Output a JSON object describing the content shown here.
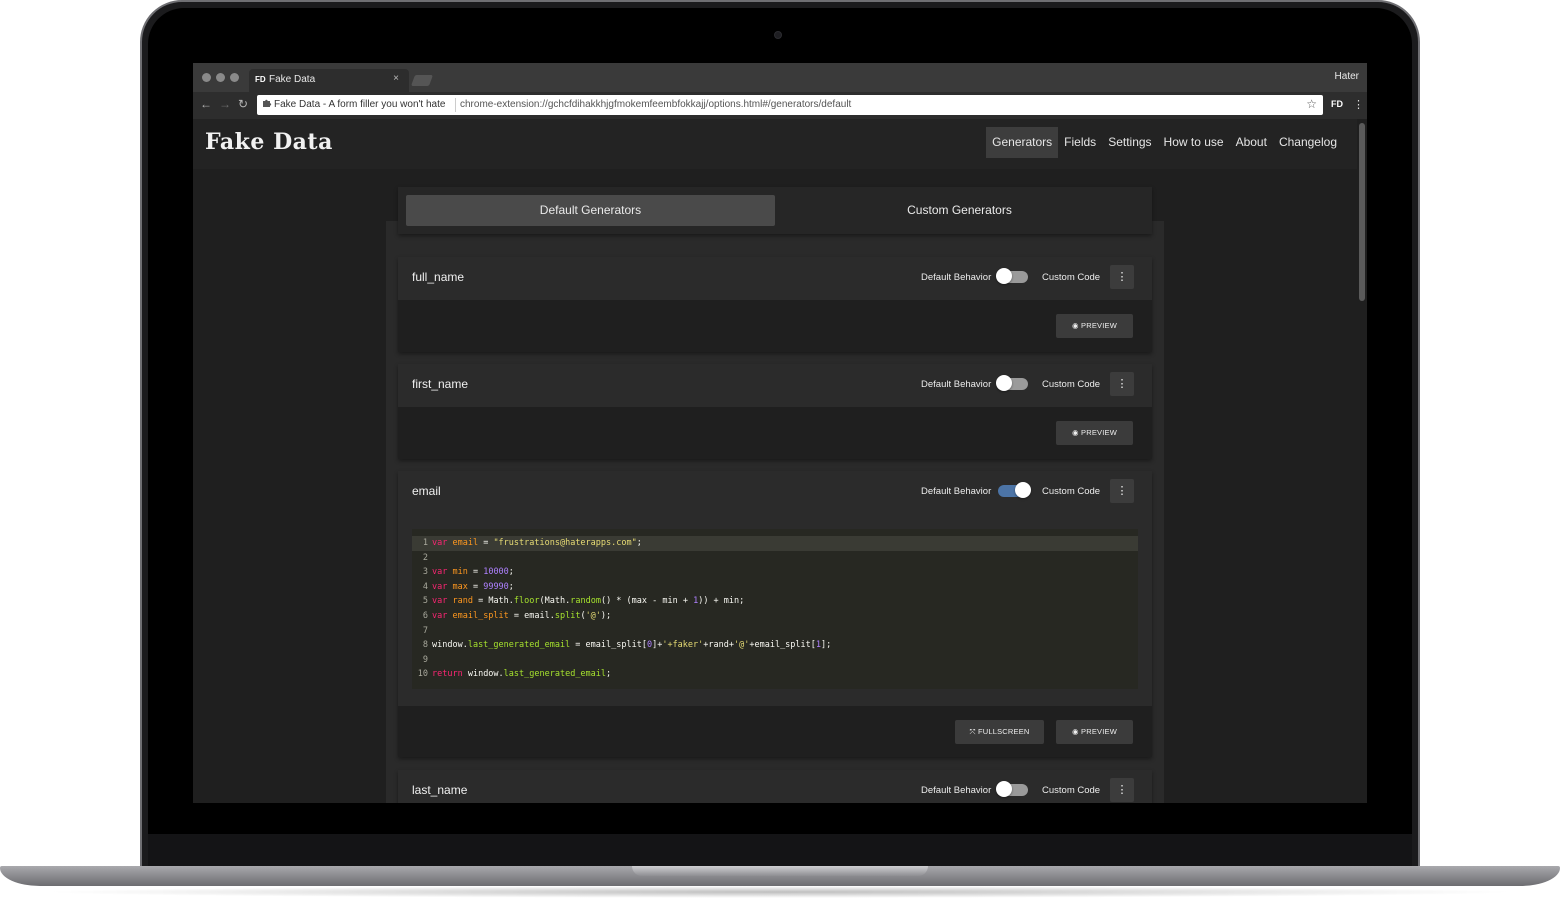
{
  "browser": {
    "tab_favicon": "FD",
    "tab_title": "Fake Data",
    "tab_close": "×",
    "profile": "Hater",
    "site_label": "Fake Data - A form filler you won't hate",
    "url": "chrome-extension://gchcfdihakkhjgfmokemfeembfokkajj/options.html#/generators/default",
    "extension_label": "FD",
    "icons": {
      "back": "←",
      "forward": "→",
      "reload": "↻",
      "star": "☆",
      "menu": "⋮",
      "site": "puzzle-icon"
    }
  },
  "app": {
    "logo": "Fake Data",
    "nav": [
      "Generators",
      "Fields",
      "Settings",
      "How to use",
      "About",
      "Changelog"
    ],
    "active_nav": "Generators"
  },
  "generator_tabs": {
    "default": "Default Generators",
    "custom": "Custom Generators"
  },
  "labels": {
    "default_behavior": "Default Behavior",
    "custom_code": "Custom Code",
    "kebab": "⋮"
  },
  "buttons": {
    "preview": "PREVIEW",
    "fullscreen": "FULLSCREEN",
    "preview_icon": "◉",
    "fullscreen_icon": "⤧"
  },
  "generators": [
    {
      "name": "full_name",
      "custom_code": false
    },
    {
      "name": "first_name",
      "custom_code": false
    },
    {
      "name": "email",
      "custom_code": true
    },
    {
      "name": "last_name",
      "custom_code": false
    }
  ],
  "code_lines": [
    {
      "n": "1",
      "parts": [
        [
          "kw",
          "var"
        ],
        [
          "def",
          " "
        ],
        [
          "var",
          "email"
        ],
        [
          "def",
          " = "
        ],
        [
          "str",
          "\"frustrations@haterapps.com\""
        ],
        [
          "def",
          ";"
        ]
      ]
    },
    {
      "n": "2",
      "parts": []
    },
    {
      "n": "3",
      "parts": [
        [
          "kw",
          "var"
        ],
        [
          "def",
          " "
        ],
        [
          "var",
          "min"
        ],
        [
          "def",
          " = "
        ],
        [
          "num",
          "10000"
        ],
        [
          "def",
          ";"
        ]
      ]
    },
    {
      "n": "4",
      "parts": [
        [
          "kw",
          "var"
        ],
        [
          "def",
          " "
        ],
        [
          "var",
          "max"
        ],
        [
          "def",
          " = "
        ],
        [
          "num",
          "99990"
        ],
        [
          "def",
          ";"
        ]
      ]
    },
    {
      "n": "5",
      "parts": [
        [
          "kw",
          "var"
        ],
        [
          "def",
          " "
        ],
        [
          "var",
          "rand"
        ],
        [
          "def",
          " = Math."
        ],
        [
          "fn",
          "floor"
        ],
        [
          "def",
          "(Math."
        ],
        [
          "fn",
          "random"
        ],
        [
          "def",
          "() * (max - min + "
        ],
        [
          "num",
          "1"
        ],
        [
          "def",
          ")) + min;"
        ]
      ]
    },
    {
      "n": "6",
      "parts": [
        [
          "kw",
          "var"
        ],
        [
          "def",
          " "
        ],
        [
          "var",
          "email_split"
        ],
        [
          "def",
          " = email."
        ],
        [
          "fn",
          "split"
        ],
        [
          "def",
          "("
        ],
        [
          "str",
          "'@'"
        ],
        [
          "def",
          ");"
        ]
      ]
    },
    {
      "n": "7",
      "parts": []
    },
    {
      "n": "8",
      "parts": [
        [
          "def",
          "window."
        ],
        [
          "fn",
          "last_generated_email"
        ],
        [
          "def",
          " = email_split["
        ],
        [
          "num",
          "0"
        ],
        [
          "def",
          "]+"
        ],
        [
          "str",
          "'+faker'"
        ],
        [
          "def",
          "+rand+"
        ],
        [
          "str",
          "'@'"
        ],
        [
          "def",
          "+email_split["
        ],
        [
          "num",
          "1"
        ],
        [
          "def",
          "];"
        ]
      ]
    },
    {
      "n": "9",
      "parts": []
    },
    {
      "n": "10",
      "parts": [
        [
          "kw",
          "return"
        ],
        [
          "def",
          " window."
        ],
        [
          "fn",
          "last_generated_email"
        ],
        [
          "def",
          ";"
        ]
      ]
    }
  ]
}
